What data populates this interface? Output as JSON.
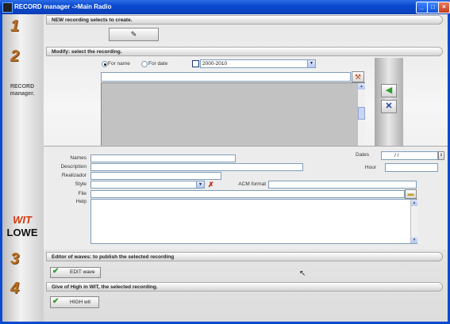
{
  "window": {
    "title": "RECORD manager   ->Main Radio"
  },
  "controls": {
    "minimize": "_",
    "maximize": "□",
    "close": "×"
  },
  "side": {
    "steps": [
      "1",
      "2",
      "3",
      "4"
    ],
    "label_top": "RECORD",
    "label_bottom": "manager.",
    "logo_top": "WIT",
    "logo_bottom": "LOWE"
  },
  "sections": {
    "new": {
      "header": "NEW recording selects to create.",
      "button_icon": "✎"
    },
    "modify": {
      "header": "Modify: select the recording.",
      "radio_name": "For name",
      "radio_date": "For date",
      "date_range": "2000-2010"
    },
    "form": {
      "names_label": "Names",
      "description_label": "Description",
      "realizador_label": "Realizador",
      "style_label": "Style",
      "file_label": "File",
      "help_label": "Help",
      "dates_label": "Dates",
      "dates_value": "/  /",
      "hour_label": "Hour",
      "acm_label": "ACM format"
    },
    "editor": {
      "header": "Editor of waves: to publish the selected recording",
      "button": "EDIT wave"
    },
    "high": {
      "header": "Give of High in WIT, the selected recording.",
      "button": "HIGH wit"
    }
  }
}
